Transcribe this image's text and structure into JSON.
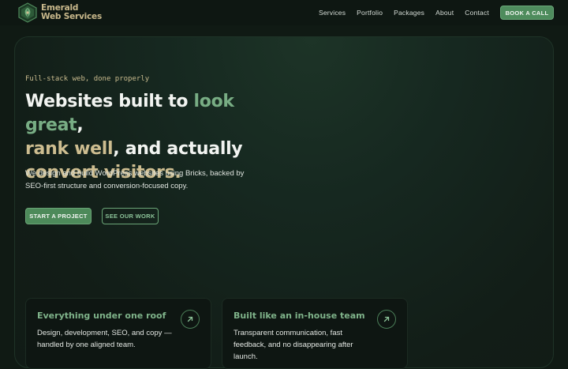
{
  "brand": {
    "name_line1": "Emerald",
    "name_line2": "Web Services",
    "logo_icon": "hexagon-leaf-logo"
  },
  "nav": {
    "items": [
      "Services",
      "Portfolio",
      "Packages",
      "About",
      "Contact"
    ],
    "cta_label": "BOOK A CALL"
  },
  "hero": {
    "eyebrow": "Full-stack web, done properly",
    "headline": {
      "part1": "Websites built to ",
      "accent1": "look great",
      "part2": ",",
      "accent2": "rank well",
      "part3": ", and actually",
      "accent3": "convert visitors."
    },
    "subtext": "We design and build WordPress websites using Bricks, backed by SEO-first structure and conversion-focused copy.",
    "primary_button": "START A PROJECT",
    "secondary_button": "SEE OUR WORK"
  },
  "cards": [
    {
      "title": "Everything under one roof",
      "body": "Design, development, SEO, and copy — handled by one aligned team.",
      "icon": "arrow-up-right-icon"
    },
    {
      "title": "Built like an in-house team",
      "body": "Transparent communication, fast feedback, and no disappearing after launch.",
      "icon": "arrow-up-right-icon"
    }
  ],
  "colors": {
    "background": "#101a14",
    "accent_green": "#78ad84",
    "accent_gold": "#cdbd90",
    "button_green": "#4d8a5a"
  }
}
